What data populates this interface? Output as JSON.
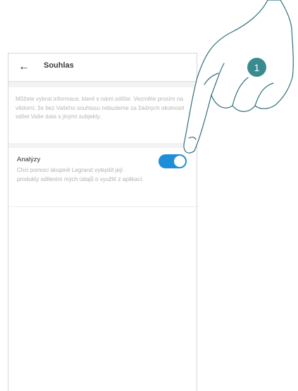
{
  "header": {
    "back_icon": "arrow-left-icon",
    "title": "Souhlas"
  },
  "intro_text": "Můžete vybrat informace, které s námi sdílíte. Vezměte prosím na vědomí, že bez Vašeho souhlasu nebudeme za žádných okolností sdílet Vaše data s jinými subjekty.",
  "settings": [
    {
      "title": "Analýzy",
      "description": "Chci pomoci skupině Legrand vylepšit její produkty sdílením mých údajů o využití z aplikací.",
      "enabled": true
    }
  ],
  "callout": {
    "number": "1"
  },
  "colors": {
    "toggle_on": "#1d8ed8",
    "callout_bg": "#3a8b8f"
  }
}
